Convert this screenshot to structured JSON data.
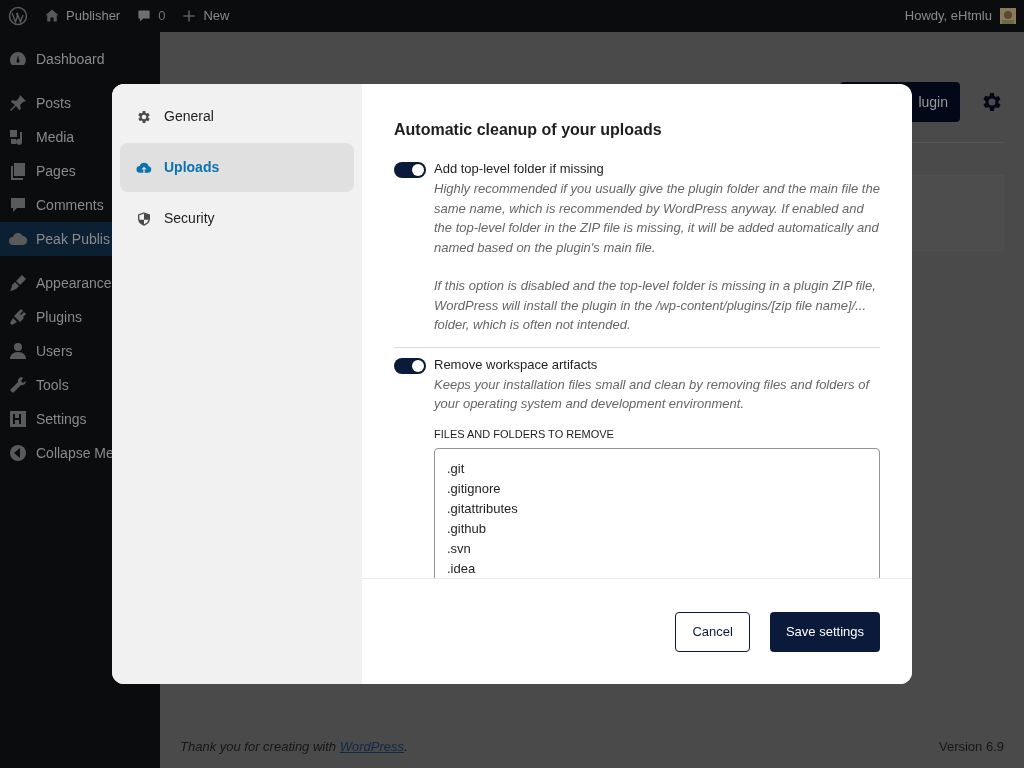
{
  "admin_bar": {
    "site": "Publisher",
    "comments": "0",
    "new": "New",
    "greeting": "Howdy, eHtmlu"
  },
  "sidebar": {
    "items": [
      {
        "label": "Dashboard",
        "selected": false
      },
      {
        "label": "Posts",
        "selected": false
      },
      {
        "label": "Media",
        "selected": false
      },
      {
        "label": "Pages",
        "selected": false
      },
      {
        "label": "Comments",
        "selected": false
      },
      {
        "label": "Peak Publis",
        "selected": true
      },
      {
        "label": "Appearance",
        "selected": false
      },
      {
        "label": "Plugins",
        "selected": false
      },
      {
        "label": "Users",
        "selected": false
      },
      {
        "label": "Tools",
        "selected": false
      },
      {
        "label": "Settings",
        "selected": false
      },
      {
        "label": "Collapse Me",
        "selected": false
      }
    ]
  },
  "page": {
    "button_fragment": "lugin"
  },
  "footer": {
    "text_before": "Thank you for creating with ",
    "link": "WordPress",
    "text_after": ".",
    "version": "Version 6.9"
  },
  "modal": {
    "nav": [
      {
        "label": "General",
        "selected": false
      },
      {
        "label": "Uploads",
        "selected": true
      },
      {
        "label": "Security",
        "selected": false
      }
    ],
    "heading": "Automatic cleanup of your uploads",
    "options": [
      {
        "label": "Add top-level folder if missing",
        "on": true,
        "paragraphs": [
          "Highly recommended if you usually give the plugin folder and the main file the same name, which is recommended by WordPress anyway. If enabled and the top-level folder in the ZIP file is missing, it will be added automatically and named based on the plugin's main file.",
          "If this option is disabled and the top-level folder is missing in a plugin ZIP file, WordPress will install the plugin in the /wp-content/plugins/[zip file name]/... folder, which is often not intended."
        ]
      },
      {
        "label": "Remove workspace artifacts",
        "on": true,
        "paragraphs": [
          "Keeps your installation files small and clean by removing files and folders of your operating system and development environment."
        ],
        "list_label": "FILES AND FOLDERS TO REMOVE",
        "list_lines": [
          ".git",
          ".gitignore",
          ".gitattributes",
          ".github",
          ".svn",
          ".idea"
        ]
      }
    ],
    "buttons": [
      {
        "label": "Cancel",
        "kind": "secondary"
      },
      {
        "label": "Save settings",
        "kind": "primary"
      }
    ]
  }
}
